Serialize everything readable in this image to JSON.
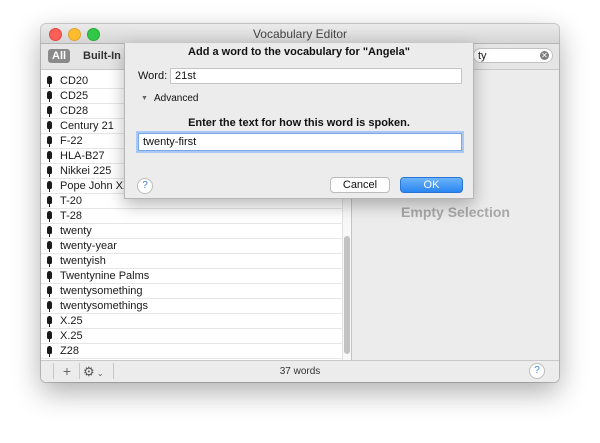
{
  "window": {
    "title": "Vocabulary Editor"
  },
  "toolbar": {
    "scope_all": "All",
    "scope_builtin": "Built-In",
    "search_value": "ty"
  },
  "list": {
    "items": [
      "CD20",
      "CD25",
      "CD28",
      "Century 21",
      "F-22",
      "HLA-B27",
      "Nikkei 225",
      "Pope John XXI",
      "T-20",
      "T-28",
      "twenty",
      "twenty-year",
      "twentyish",
      "Twentynine Palms",
      "twentysomething",
      "twentysomethings",
      "X.25",
      "X.25",
      "Z28"
    ],
    "scroll_position": 0.75
  },
  "detail": {
    "empty_label": "Empty Selection"
  },
  "bottombar": {
    "add_label": "+",
    "word_count": "37 words",
    "help_label": "?"
  },
  "sheet": {
    "title": "Add a word to the vocabulary for \"Angela\"",
    "word_label": "Word:",
    "word_value": "21st",
    "advanced_label": "Advanced",
    "spoken_prompt": "Enter the text for how this word is spoken.",
    "spoken_value": "twenty-first",
    "help_label": "?",
    "cancel_label": "Cancel",
    "ok_label": "OK"
  },
  "colors": {
    "accent": "#2a86f1",
    "scope_selected": "#8a8a8a",
    "empty_text": "#a8a8a8"
  },
  "icons": {
    "close": "close-icon",
    "minimize": "minimize-icon",
    "zoom": "zoom-icon",
    "search_clear": "clear-search-icon",
    "row": "microphone-icon",
    "add": "plus-icon",
    "action": "gear-icon",
    "help": "help-icon",
    "disclosure": "disclosure-triangle-icon"
  }
}
